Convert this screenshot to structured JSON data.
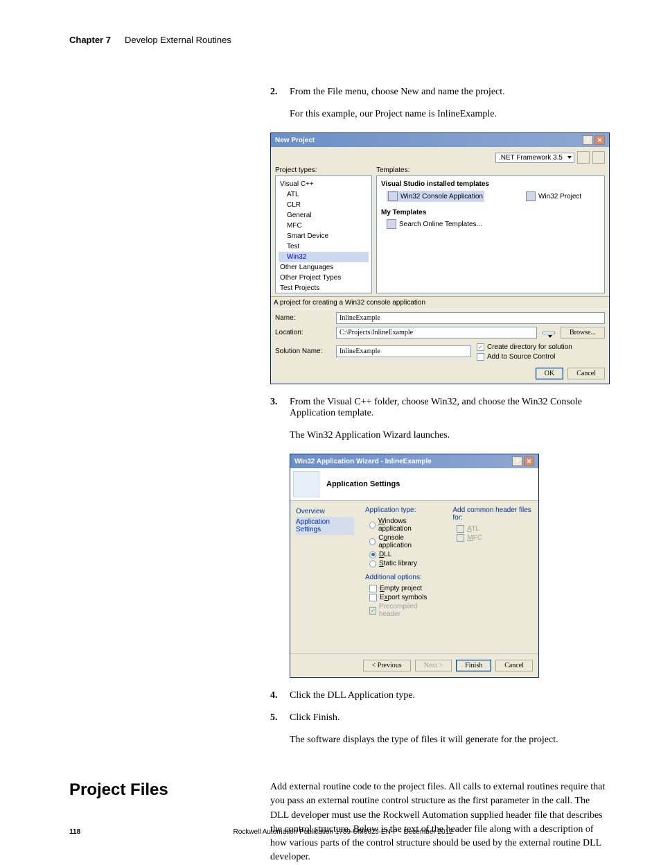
{
  "header": {
    "chapter": "Chapter 7",
    "title": "Develop External Routines"
  },
  "steps": {
    "s2_num": "2.",
    "s2_text": "From the File menu, choose New and name the project.",
    "s2_note": "For this example, our Project name is InlineExample.",
    "s3_num": "3.",
    "s3_text": "From the Visual C++ folder, choose Win32, and choose the Win32 Console Application template.",
    "s3_note": "The Win32 Application Wizard launches.",
    "s4_num": "4.",
    "s4_text": "Click the DLL Application type.",
    "s5_num": "5.",
    "s5_text": "Click Finish.",
    "s5_note": "The software displays the type of files it will generate for the project."
  },
  "np": {
    "title": "New Project",
    "project_types_label": "Project types:",
    "templates_label": "Templates:",
    "framework": ".NET Framework 3.5",
    "tree": {
      "visual_cpp": "Visual C++",
      "atl": "ATL",
      "clr": "CLR",
      "general": "General",
      "mfc": "MFC",
      "smart_device": "Smart Device",
      "test": "Test",
      "win32": "Win32",
      "other_lang": "Other Languages",
      "other_proj": "Other Project Types",
      "test_proj": "Test Projects"
    },
    "tmpl_header1": "Visual Studio installed templates",
    "tmpl_console": "Win32 Console Application",
    "tmpl_project": "Win32 Project",
    "tmpl_header2": "My Templates",
    "tmpl_search": "Search Online Templates...",
    "desc": "A project for creating a Win32 console application",
    "name_label": "Name:",
    "name_value": "InlineExample",
    "location_label": "Location:",
    "location_value": "C:\\Projects\\InlineExample",
    "browse": "Browse...",
    "solution_label": "Solution Name:",
    "solution_value": "InlineExample",
    "chk_create": "Create directory for solution",
    "chk_source": "Add to Source Control",
    "ok": "OK",
    "cancel": "Cancel"
  },
  "wiz": {
    "title": "Win32 Application Wizard - InlineExample",
    "banner": "Application Settings",
    "nav_overview": "Overview",
    "nav_settings": "Application Settings",
    "app_type_label": "Application type:",
    "app_windows": "Windows application",
    "app_console": "Console application",
    "app_dll": "DLL",
    "app_static": "Static library",
    "addl_label": "Additional options:",
    "addl_empty": "Empty project",
    "addl_export": "Export symbols",
    "addl_precomp": "Precompiled header",
    "common_label": "Add common header files for:",
    "common_atl": "ATL",
    "common_mfc": "MFC",
    "prev": "< Previous",
    "next": "Next >",
    "finish": "Finish",
    "cancel": "Cancel"
  },
  "section": {
    "heading": "Project Files",
    "body": "Add external routine code to the project files. All calls to external routines require that you pass an external routine control structure as the first parameter in the call. The DLL developer must use the Rockwell Automation supplied header file that describes the control structure. Below is the text of the header file along with a description of how various parts of the control structure should be used by the external routine DLL developer."
  },
  "footer": {
    "page": "118",
    "pub": "Rockwell Automation Publication 1789-UM002J-EN-P - December 2012"
  }
}
